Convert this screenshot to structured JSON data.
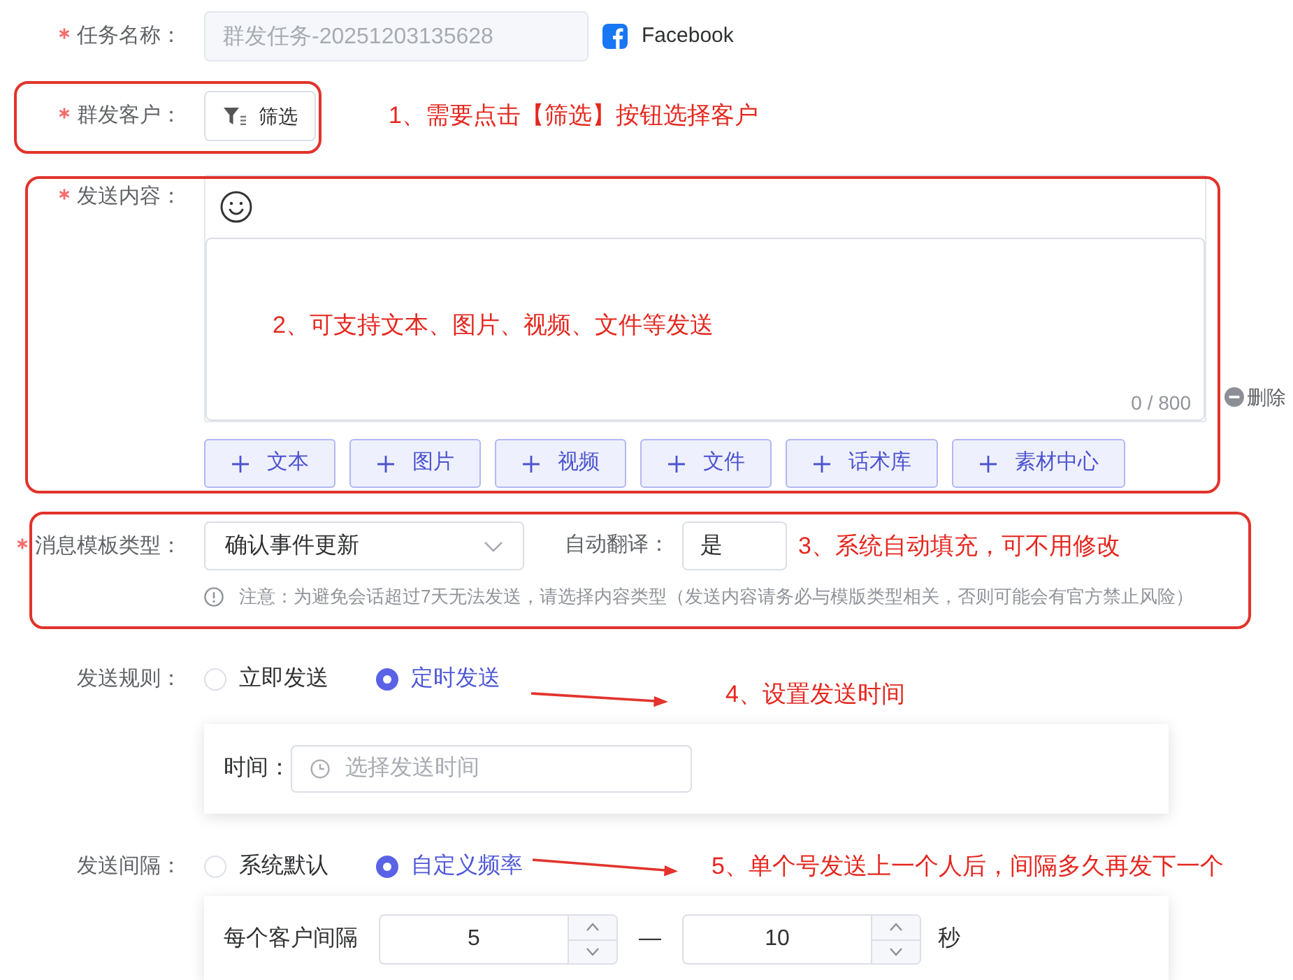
{
  "task_name": {
    "label": "任务名称：",
    "required": true,
    "value": "群发任务-20251203135628",
    "disabled": true,
    "platform": "Facebook"
  },
  "recipients": {
    "label": "群发客户：",
    "required": true,
    "filter_button": "筛选",
    "annotation": {
      "kind": "frame",
      "text": "1、需要点击【筛选】按钮选择客户"
    }
  },
  "content": {
    "label": "发送内容：",
    "required": true,
    "counter": "0 / 800",
    "delete_label": "删除",
    "add_buttons": [
      "文本",
      "图片",
      "视频",
      "文件",
      "话术库",
      "素材中心"
    ],
    "annotation": {
      "kind": "frame",
      "text": "2、可支持文本、图片、视频、文件等发送"
    }
  },
  "template": {
    "label": "消息模板类型：",
    "required": true,
    "value": "确认事件更新",
    "translate_label": "自动翻译：",
    "translate_value": "是",
    "note": "注意：为避免会话超过7天无法发送，请选择内容类型（发送内容请务必与模版类型相关，否则可能会有官方禁止风险）",
    "annotation": {
      "kind": "frame",
      "text": "3、系统自动填充，可不用修改"
    }
  },
  "send_rule": {
    "label": "发送规则：",
    "options": [
      {
        "label": "立即发送",
        "selected": false
      },
      {
        "label": "定时发送",
        "selected": true
      }
    ],
    "time_label": "时间：",
    "time_placeholder": "选择发送时间",
    "annotation": {
      "kind": "arrow",
      "text": "4、设置发送时间"
    }
  },
  "send_interval": {
    "label": "发送间隔：",
    "options": [
      {
        "label": "系统默认",
        "selected": false
      },
      {
        "label": "自定义频率",
        "selected": true
      }
    ],
    "interval_label": "每个客户间隔",
    "min_value": "5",
    "separator": "—",
    "max_value": "10",
    "unit": "秒",
    "annotation": {
      "kind": "arrow",
      "text": "5、单个号发送上一个人后，间隔多久再发下一个"
    }
  }
}
